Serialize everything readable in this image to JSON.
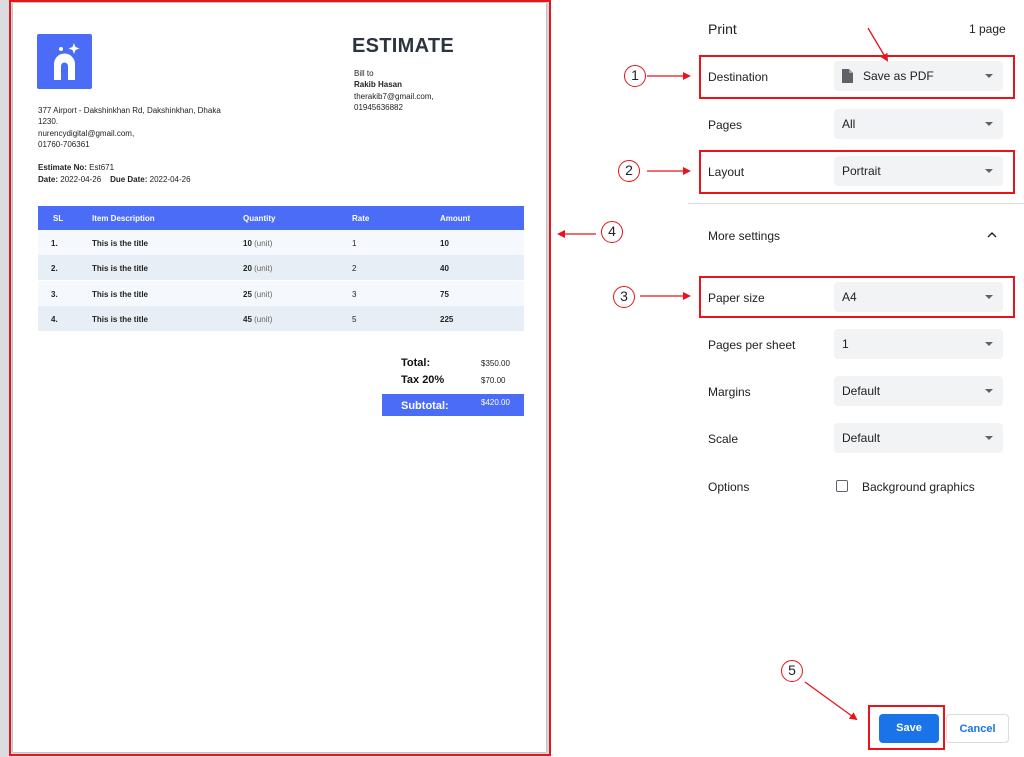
{
  "invoice": {
    "title": "ESTIMATE",
    "bill_to_label": "Bill to",
    "bill_to_name": "Rakib Hasan",
    "bill_to_email": "therakib7@gmail.com,",
    "bill_to_phone": "01945636882",
    "address_line1": "377 Airport - Dakshinkhan Rd, Dakshinkhan, Dhaka",
    "address_line2": "1230.",
    "company_email": "nurencydigital@gmail.com,",
    "company_phone": "01760-706361",
    "estimate_no_label": "Estimate No:",
    "estimate_no": "Est671",
    "date_label": "Date:",
    "date": "2022-04-26",
    "due_date_label": "Due Date:",
    "due_date": "2022-04-26",
    "columns": [
      "SL",
      "Item Description",
      "Quantity",
      "Rate",
      "Amount"
    ],
    "unit_label": "(unit)",
    "rows": [
      {
        "sl": "1.",
        "desc": "This is the title",
        "qty": "10",
        "rate": "1",
        "amount": "10"
      },
      {
        "sl": "2.",
        "desc": "This is the title",
        "qty": "20",
        "rate": "2",
        "amount": "40"
      },
      {
        "sl": "3.",
        "desc": "This is the title",
        "qty": "25",
        "rate": "3",
        "amount": "75"
      },
      {
        "sl": "4.",
        "desc": "This is the title",
        "qty": "45",
        "rate": "5",
        "amount": "225"
      }
    ],
    "total_label": "Total:",
    "total_value": "$350.00",
    "tax_label": "Tax 20%",
    "tax_value": "$70.00",
    "subtotal_label": "Subtotal:",
    "subtotal_value": "$420.00"
  },
  "panel": {
    "title": "Print",
    "page_count": "1 page",
    "destination_label": "Destination",
    "destination_value": "Save as PDF",
    "pages_label": "Pages",
    "pages_value": "All",
    "layout_label": "Layout",
    "layout_value": "Portrait",
    "more_settings_label": "More settings",
    "paper_size_label": "Paper size",
    "paper_size_value": "A4",
    "pages_per_sheet_label": "Pages per sheet",
    "pages_per_sheet_value": "1",
    "margins_label": "Margins",
    "margins_value": "Default",
    "scale_label": "Scale",
    "scale_value": "Default",
    "options_label": "Options",
    "background_graphics_label": "Background graphics",
    "save_label": "Save",
    "cancel_label": "Cancel"
  },
  "annotations": [
    "1",
    "2",
    "3",
    "4",
    "5"
  ],
  "colors": {
    "accent": "#4a6cf7",
    "button": "#1a73e8",
    "annotation": "#e8141b"
  }
}
